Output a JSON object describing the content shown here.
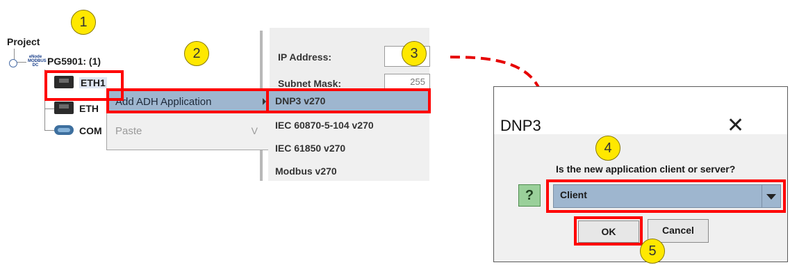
{
  "tree": {
    "root": "Project",
    "device": "PG5901: (1)",
    "device_icon_text": "eNode MODBUS DC",
    "nodes": [
      "ETH1",
      "ETH",
      "COM"
    ]
  },
  "form": {
    "ip_label": "IP Address:",
    "subnet_label": "Subnet Mask:",
    "subnet_value": "255"
  },
  "context_menu": {
    "items": [
      {
        "label": "Add ADH Application",
        "has_submenu": true,
        "enabled": true
      },
      {
        "label": "Paste",
        "shortcut": "V",
        "enabled": false
      }
    ]
  },
  "submenu": {
    "items": [
      "DNP3   v270",
      "IEC 60870-5-104   v270",
      "IEC 61850   v270",
      "Modbus   v270"
    ]
  },
  "dialog": {
    "title": "DNP3",
    "close": "✕",
    "icon": "?",
    "question": "Is the new application client or server?",
    "selected": "Client",
    "ok_label": "OK",
    "cancel_label": "Cancel"
  },
  "steps": [
    "1",
    "2",
    "3",
    "4",
    "5"
  ],
  "colors": {
    "highlight": "#ff0000",
    "badge": "#ffe800",
    "selection": "#9eb6cf"
  }
}
